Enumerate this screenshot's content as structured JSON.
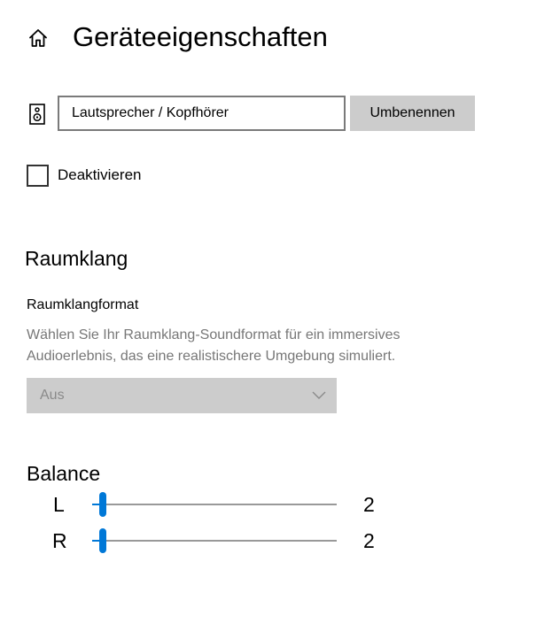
{
  "header": {
    "title": "Geräteeigenschaften",
    "home_icon": "home-icon"
  },
  "device": {
    "icon": "speaker-icon",
    "name_value": "Lautsprecher / Kopfhörer",
    "rename_label": "Umbenennen"
  },
  "disable": {
    "label": "Deaktivieren",
    "checked": false
  },
  "spatial_sound": {
    "section_title": "Raumklang",
    "field_label": "Raumklangformat",
    "description": "Wählen Sie Ihr Raumklang-Soundformat für ein immersives Audioerlebnis, das eine realistischere Umgebung simuliert.",
    "selected_value": "Aus",
    "enabled": false
  },
  "balance": {
    "title": "Balance",
    "channels": [
      {
        "label": "L",
        "value": "2",
        "level": 0.02
      },
      {
        "label": "R",
        "value": "2",
        "level": 0.02
      }
    ]
  },
  "colors": {
    "accent": "#0078d7",
    "disabled_bg": "#cccccc",
    "disabled_text": "#8a8a8a",
    "description_text": "#777777",
    "track": "#999999"
  }
}
